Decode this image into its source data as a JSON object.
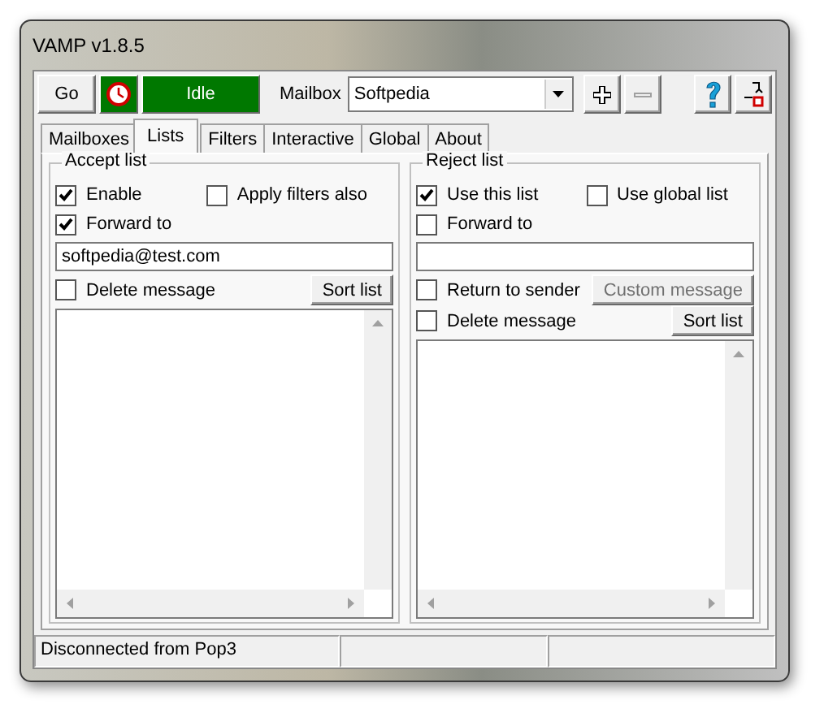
{
  "window": {
    "title": "VAMP v1.8.5"
  },
  "toolbar": {
    "go": "Go",
    "state": "Idle",
    "mailbox_label": "Mailbox",
    "mailbox": "Softpedia"
  },
  "tabs": [
    {
      "label": "Mailboxes",
      "selected": false
    },
    {
      "label": "Lists",
      "selected": true
    },
    {
      "label": "Filters",
      "selected": false
    },
    {
      "label": "Interactive",
      "selected": false
    },
    {
      "label": "Global",
      "selected": false
    },
    {
      "label": "About",
      "selected": false
    }
  ],
  "groups": [
    {
      "title": "Accept list",
      "rows": [
        [
          {
            "kind": "checkbox",
            "label": "Enable",
            "checked": true
          },
          {
            "kind": "checkbox",
            "label": "Apply filters also",
            "checked": false
          }
        ],
        [
          {
            "kind": "checkbox",
            "label": "Forward to",
            "checked": true
          }
        ],
        [
          {
            "kind": "field",
            "value": "softpedia@test.com"
          }
        ],
        [
          {
            "kind": "checkbox",
            "label": "Delete message",
            "checked": false
          },
          {
            "kind": "button",
            "label": "Sort list",
            "disabled": false
          }
        ]
      ]
    },
    {
      "title": "Reject list",
      "rows": [
        [
          {
            "kind": "checkbox",
            "label": "Use this list",
            "checked": true
          },
          {
            "kind": "checkbox",
            "label": "Use global list",
            "checked": false
          }
        ],
        [
          {
            "kind": "checkbox",
            "label": "Forward to",
            "checked": false
          }
        ],
        [
          {
            "kind": "field"
          }
        ],
        [
          {
            "kind": "checkbox",
            "label": "Return to sender",
            "checked": false
          },
          {
            "kind": "button",
            "label": "Custom message",
            "disabled": true
          }
        ],
        [
          {
            "kind": "checkbox",
            "label": "Delete message",
            "checked": false
          },
          {
            "kind": "button",
            "label": "Sort list",
            "disabled": false
          }
        ]
      ]
    }
  ],
  "status_bar": [
    "Disconnected from Pop3"
  ]
}
